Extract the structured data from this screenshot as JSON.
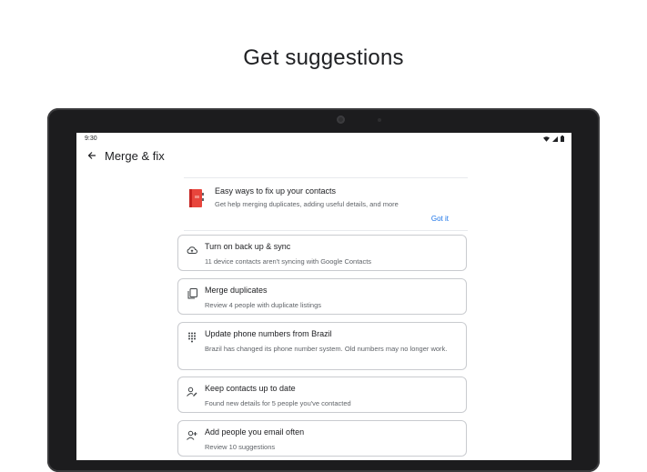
{
  "promo": {
    "title": "Get suggestions"
  },
  "status_bar": {
    "time": "9:30"
  },
  "app_bar": {
    "title": "Merge & fix"
  },
  "info_card": {
    "title": "Easy ways to fix up your contacts",
    "subtitle": "Get help merging duplicates, adding useful details, and more",
    "action": "Got it"
  },
  "suggestions": [
    {
      "icon": "cloud-sync-icon",
      "title": "Turn on back up & sync",
      "subtitle": "11 device contacts aren't syncing with Google Contacts"
    },
    {
      "icon": "merge-duplicates-icon",
      "title": "Merge duplicates",
      "subtitle": "Review 4 people with duplicate listings"
    },
    {
      "icon": "dialpad-icon",
      "title": "Update phone numbers from Brazil",
      "subtitle": "Brazil has changed its phone number system. Old numbers may no longer work."
    },
    {
      "icon": "person-edit-icon",
      "title": "Keep contacts up to date",
      "subtitle": "Found new details for 5 people you've contacted"
    },
    {
      "icon": "person-add-icon",
      "title": "Add people you email often",
      "subtitle": "Review 10 suggestions"
    }
  ],
  "colors": {
    "accent": "#1a73e8",
    "illustration": "#e8453c"
  }
}
